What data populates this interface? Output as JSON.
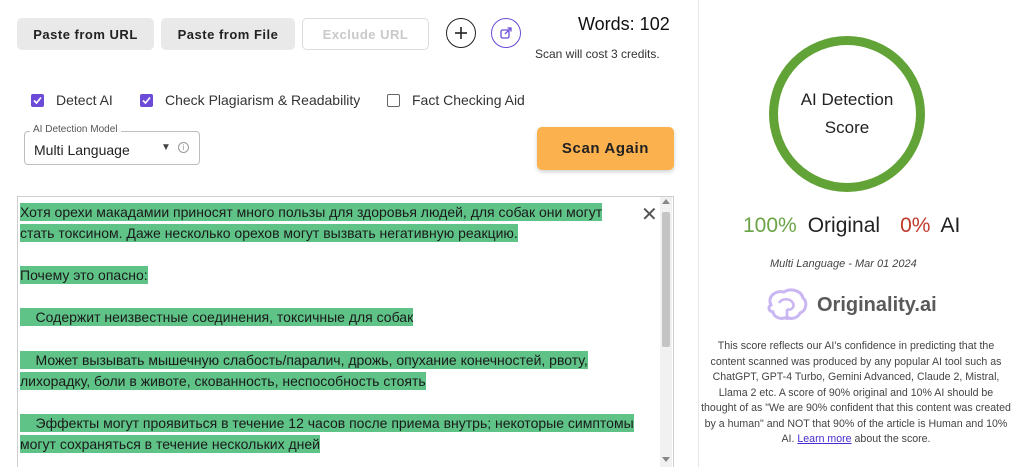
{
  "toolbar": {
    "paste_url": "Paste from URL",
    "paste_file": "Paste from File",
    "exclude_url": "Exclude URL",
    "words": "Words: 102",
    "cost": "Scan will cost 3 credits."
  },
  "options": {
    "detect_ai": {
      "label": "Detect AI",
      "checked": true
    },
    "plagiarism": {
      "label": "Check Plagiarism & Readability",
      "checked": true
    },
    "fact_check": {
      "label": "Fact Checking Aid",
      "checked": false
    }
  },
  "model_select": {
    "legend": "AI Detection Model",
    "value": "Multi Language"
  },
  "scan_button": "Scan Again",
  "content": {
    "p1_l1": "Хотя орехи макадамии приносят много пользы для здоровья людей, для собак они могут",
    "p1_l2": "стать токсином. Даже несколько орехов могут вызвать негативную реакцию.",
    "p2": "Почему это опасно:",
    "p3": "    Содержит неизвестные соединения, токсичные для собак",
    "p4_l1": "    Может вызывать мышечную слабость/паралич, дрожь, опухание конечностей, рвоту,",
    "p4_l2": "лихорадку, боли в животе, скованность, неспособность стоять",
    "p5_l1": "    Эффекты могут проявиться в течение 12 часов после приема внутрь; некоторые симптомы",
    "p5_l2": "могут сохраняться в течение нескольких дней"
  },
  "score": {
    "title": "AI Detection Score",
    "original_pct": "100%",
    "original_label": "Original",
    "ai_pct": "0%",
    "ai_label": "AI",
    "meta": "Multi Language - Mar 01 2024",
    "brand": "Originality.ai",
    "explain_main": "This score reflects our AI's confidence in predicting that the content scanned was produced by any popular AI tool such as ChatGPT, GPT-4 Turbo, Gemini Advanced, Claude 2, Mistral, Llama 2 etc. A score of 90% original and 10% AI should be thought of as \"We are 90% confident that this content was created by a human\" and NOT that 90% of the article is Human and 10% AI.",
    "learn_more": "Learn more",
    "explain_tail": "about the score."
  },
  "colors": {
    "accent_purple": "#6b4bd8",
    "scan_orange": "#fbb24e",
    "highlight_green": "#5fc387",
    "ring_green": "#62a337",
    "ai_red": "#c0392b"
  }
}
